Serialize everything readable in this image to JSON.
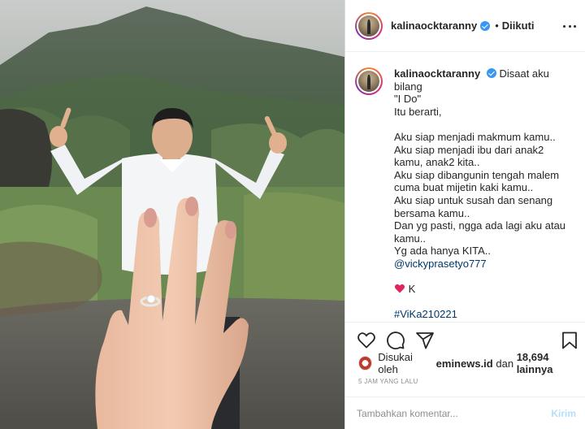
{
  "post": {
    "username": "kalinaocktaranny",
    "follow_state": "Diikuti",
    "dot": "•"
  },
  "caption": {
    "username": "kalinaocktaranny",
    "text": "Disaat aku bilang \n\"I Do\"\nItu berarti,\n\nAku siap menjadi makmum kamu..\nAku siap menjadi ibu dari anak2 kamu, anak2 kita..\nAku siap dibangunin tengah malem cuma buat mijetin kaki kamu..\nAku siap untuk susah dan senang bersama kamu..\nDan yg pasti, ngga ada lagi aku atau kamu..\nYg ada hanya KITA..",
    "mention": "@vickyprasetyo777",
    "emoji_letter": "K",
    "hashtag": "#ViKa210221"
  },
  "likes": {
    "prefix": "Disukai oleh",
    "liker": "eminews.id",
    "conjunction": "dan",
    "count": "18,694 lainnya"
  },
  "timestamp": "5 JAM YANG LALU",
  "comment_box": {
    "placeholder": "Tambahkan komentar...",
    "post_label": "Kirim"
  },
  "icons": {
    "like": "heart-outline-icon",
    "comment": "comment-bubble-icon",
    "share": "paper-plane-icon",
    "save": "bookmark-icon",
    "more": "more-horizontal-icon",
    "verified": "verified-badge-icon"
  },
  "colors": {
    "link": "#00376b",
    "verified": "#3897f0",
    "heart_emoji": "#e0245e",
    "post_button_disabled": "#b2dffc"
  }
}
